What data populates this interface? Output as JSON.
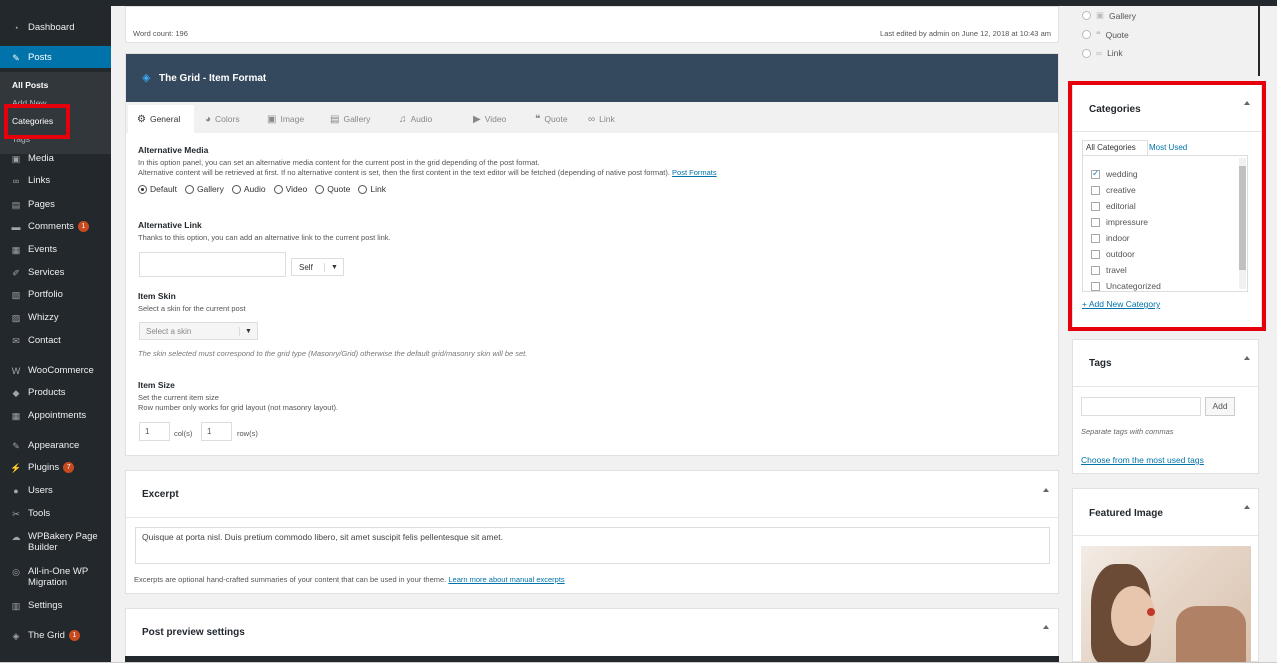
{
  "sidebar": {
    "items": [
      {
        "label": "Dashboard",
        "icon": "dashboard-icon",
        "glyph": "◔"
      },
      {
        "label": "Posts",
        "icon": "pin-icon",
        "glyph": "✎"
      },
      {
        "label": "Media",
        "icon": "media-icon",
        "glyph": "▣"
      },
      {
        "label": "Links",
        "icon": "link-icon",
        "glyph": "∞"
      },
      {
        "label": "Pages",
        "icon": "pages-icon",
        "glyph": "▤"
      },
      {
        "label": "Comments",
        "icon": "comment-icon",
        "glyph": "▬",
        "badge": "1"
      },
      {
        "label": "Events",
        "icon": "calendar-icon",
        "glyph": "▦"
      },
      {
        "label": "Services",
        "icon": "services-icon",
        "glyph": "✐"
      },
      {
        "label": "Portfolio",
        "icon": "portfolio-icon",
        "glyph": "▧"
      },
      {
        "label": "Whizzy",
        "icon": "whizzy-icon",
        "glyph": "▨"
      },
      {
        "label": "Contact",
        "icon": "mail-icon",
        "glyph": "✉"
      },
      {
        "label": "WooCommerce",
        "icon": "woocommerce-icon",
        "glyph": "W"
      },
      {
        "label": "Products",
        "icon": "products-icon",
        "glyph": "◆"
      },
      {
        "label": "Appointments",
        "icon": "appointments-icon",
        "glyph": "▦"
      },
      {
        "label": "Appearance",
        "icon": "brush-icon",
        "glyph": "✎"
      },
      {
        "label": "Plugins",
        "icon": "plugin-icon",
        "glyph": "⚡",
        "badge": "7"
      },
      {
        "label": "Users",
        "icon": "users-icon",
        "glyph": "●"
      },
      {
        "label": "Tools",
        "icon": "tools-icon",
        "glyph": "✂"
      },
      {
        "label": "WPBakery Page Builder",
        "icon": "wpbakery-icon",
        "glyph": "☁"
      },
      {
        "label": "All-in-One WP Migration",
        "icon": "migration-icon",
        "glyph": "◎"
      },
      {
        "label": "Settings",
        "icon": "settings-icon",
        "glyph": "▥"
      },
      {
        "label": "The Grid",
        "icon": "thegrid-icon",
        "glyph": "◈",
        "badge": "1"
      }
    ],
    "submenu": [
      "All Posts",
      "Add New",
      "Categories",
      "Tags"
    ]
  },
  "editor": {
    "word_count": "Word count: 196",
    "last_edited": "Last edited by admin on June 12, 2018 at 10:43 am"
  },
  "grid": {
    "title": "The Grid - Item Format",
    "tabs": [
      {
        "label": "General",
        "icon": "gear-icon",
        "glyph": "⚙"
      },
      {
        "label": "Colors",
        "icon": "palette-icon",
        "glyph": "◕"
      },
      {
        "label": "Image",
        "icon": "image-icon",
        "glyph": "▣"
      },
      {
        "label": "Gallery",
        "icon": "gallery-icon",
        "glyph": "▤"
      },
      {
        "label": "Audio",
        "icon": "audio-icon",
        "glyph": "♫"
      },
      {
        "label": "Video",
        "icon": "video-icon",
        "glyph": "▶"
      },
      {
        "label": "Quote",
        "icon": "quote-icon",
        "glyph": "❝"
      },
      {
        "label": "Link",
        "icon": "link-icon",
        "glyph": "∞"
      }
    ],
    "alt_media_title": "Alternative Media",
    "alt_media_desc1": "In this option panel, you can set an alternative media content for the current post in the grid depending of the post format.",
    "alt_media_desc2": "Alternative content will be retrieved at first. If no alternative content is set, then the first content in the text editor will be fetched (depending of native post format).",
    "post_formats_link": "Post Formats",
    "media_options": [
      "Default",
      "Gallery",
      "Audio",
      "Video",
      "Quote",
      "Link"
    ],
    "alt_link_title": "Alternative Link",
    "alt_link_desc": "Thanks to this option, you can add an alternative link to the current post link.",
    "link_target": "Self",
    "skin_title": "Item Skin",
    "skin_desc": "Select a skin for the current post",
    "skin_placeholder": "Select a skin",
    "skin_note": "The skin selected must correspond to the grid type (Masonry/Grid) otherwise the default grid/masonry skin will be set.",
    "size_title": "Item Size",
    "size_desc1": "Set the current item size",
    "size_desc2": "Row number only works for grid layout (not masonry layout).",
    "cols": "1",
    "cols_label": "col(s)",
    "rows": "1",
    "rows_label": "row(s)"
  },
  "excerpt": {
    "title": "Excerpt",
    "text": "Quisque at porta nisl. Duis pretium commodo libero, sit amet suscipit felis pellentesque sit amet.",
    "help": "Excerpts are optional hand-crafted summaries of your content that can be used in your theme.",
    "help_link": "Learn more about manual excerpts"
  },
  "preview": {
    "title": "Post preview settings"
  },
  "formats": [
    "Gallery",
    "Quote",
    "Link"
  ],
  "categories": {
    "title": "Categories",
    "tab_all": "All Categories",
    "tab_used": "Most Used",
    "items": [
      {
        "label": "wedding",
        "checked": true
      },
      {
        "label": "creative",
        "checked": false
      },
      {
        "label": "editorial",
        "checked": false
      },
      {
        "label": "impressure",
        "checked": false
      },
      {
        "label": "indoor",
        "checked": false
      },
      {
        "label": "outdoor",
        "checked": false
      },
      {
        "label": "travel",
        "checked": false
      },
      {
        "label": "Uncategorized",
        "checked": false
      }
    ],
    "add_new": "+ Add New Category"
  },
  "tags": {
    "title": "Tags",
    "add_button": "Add",
    "help": "Separate tags with commas",
    "choose_link": "Choose from the most used tags"
  },
  "featured": {
    "title": "Featured Image"
  },
  "colors": {
    "accent": "#0073aa",
    "sidebar": "#23282d",
    "highlight": "#e5000b",
    "grid_header": "#34495e"
  }
}
